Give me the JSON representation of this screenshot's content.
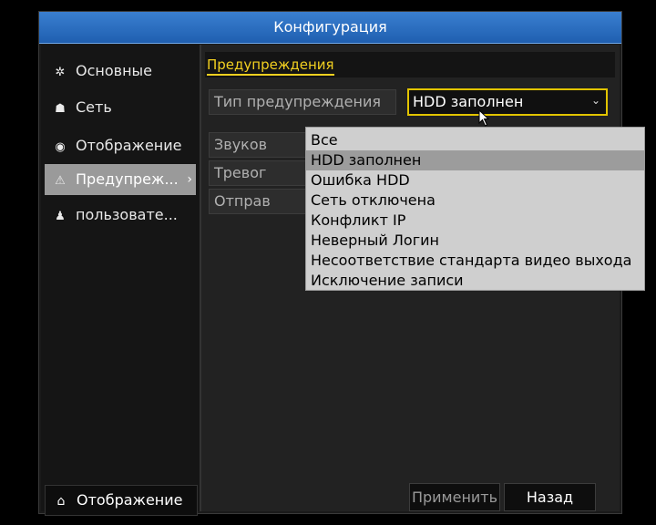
{
  "window": {
    "title": "Конфигурация"
  },
  "sidebar": {
    "items": [
      {
        "label": "Основные",
        "icon": "gear-icon"
      },
      {
        "label": "Сеть",
        "icon": "network-icon"
      },
      {
        "label": "Отображение",
        "icon": "eye-icon"
      },
      {
        "label": "Предупреж...",
        "icon": "warning-icon",
        "active": true
      },
      {
        "label": "пользовате...",
        "icon": "users-icon"
      }
    ],
    "bottom": {
      "label": "Отображение",
      "icon": "home-icon"
    }
  },
  "content": {
    "section_title": "Предупреждения",
    "alert_type_label": "Тип предупреждения",
    "alert_type_value": "HDD заполнен",
    "rows": [
      "Звуков",
      "Тревог",
      "Отправ"
    ],
    "dropdown": {
      "options": [
        "Все",
        "HDD заполнен",
        "Ошибка HDD",
        "Сеть отключена",
        "Конфликт IP",
        "Неверный Логин",
        "Несоответствие стандарта видео выхода",
        "Исключение записи"
      ],
      "highlighted": "HDD заполнен"
    },
    "buttons": {
      "apply": "Применить",
      "back": "Назад"
    }
  },
  "colors": {
    "title_bar": "#2a6cc0",
    "highlight": "#e2c400",
    "active_item": "#9a9a9a"
  }
}
